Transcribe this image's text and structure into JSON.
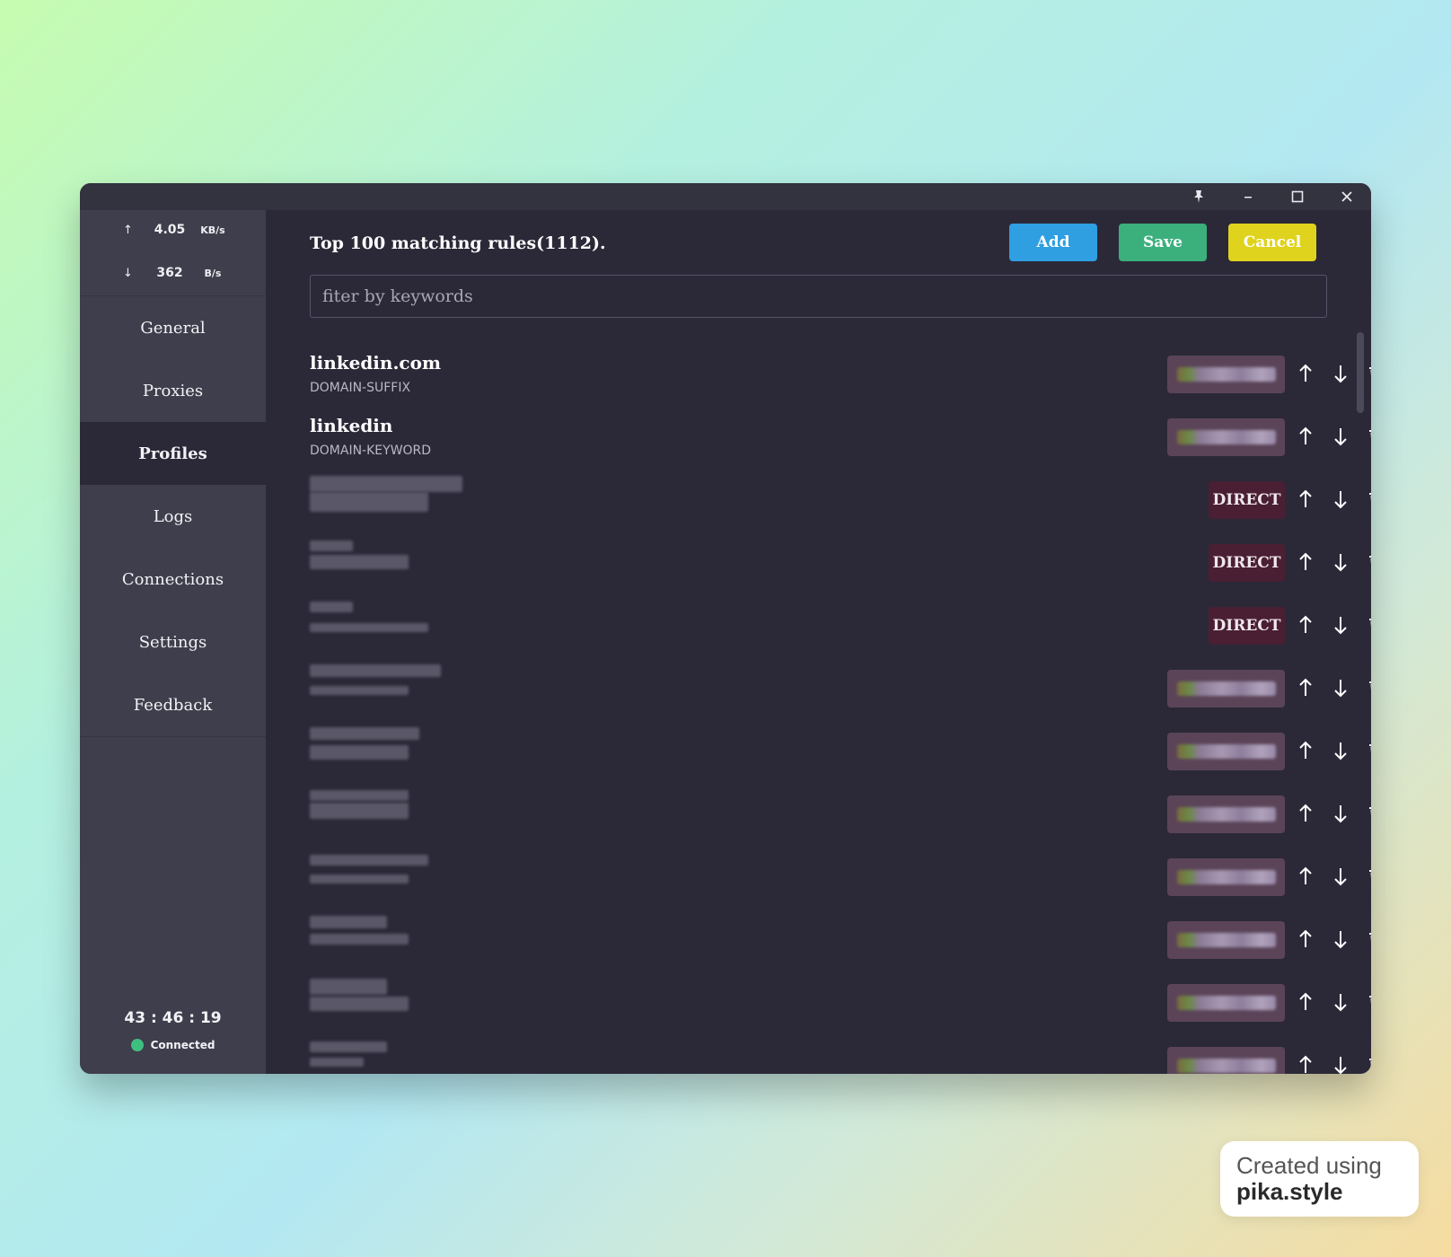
{
  "window": {
    "controls": [
      "pin-icon",
      "minimize-icon",
      "maximize-icon",
      "close-icon"
    ]
  },
  "sidebar": {
    "traffic": {
      "up_arrow": "↑",
      "up_value": "4.05",
      "up_unit": "KB/s",
      "down_arrow": "↓",
      "down_value": "362",
      "down_unit": "B/s"
    },
    "nav": [
      {
        "label": "General"
      },
      {
        "label": "Proxies"
      },
      {
        "label": "Profiles"
      },
      {
        "label": "Logs"
      },
      {
        "label": "Connections"
      },
      {
        "label": "Settings"
      },
      {
        "label": "Feedback"
      }
    ],
    "active_index": 2,
    "timer": "43 : 46 : 19",
    "status_label": "Connected",
    "status_color": "#3fbf7f"
  },
  "main": {
    "title": "Top 100 matching rules(1112).",
    "buttons": {
      "add": "Add",
      "save": "Save",
      "cancel": "Cancel"
    },
    "button_colors": {
      "add": "#2f9fe2",
      "save": "#3bb07d",
      "cancel": "#e0d31e"
    },
    "filter_placeholder": "fiter by keywords",
    "filter_value": "",
    "rules": [
      {
        "payload": "linkedin.com",
        "type": "DOMAIN-SUFFIX",
        "policy": "",
        "policy_kind": "blurred"
      },
      {
        "payload": "linkedin",
        "type": "DOMAIN-KEYWORD",
        "policy": "",
        "policy_kind": "blurred"
      },
      {
        "payload": "",
        "type": "",
        "policy": "DIRECT",
        "policy_kind": "direct"
      },
      {
        "payload": "",
        "type": "",
        "policy": "DIRECT",
        "policy_kind": "direct"
      },
      {
        "payload": "",
        "type": "",
        "policy": "DIRECT",
        "policy_kind": "direct"
      },
      {
        "payload": "",
        "type": "",
        "policy": "",
        "policy_kind": "blurred"
      },
      {
        "payload": "",
        "type": "",
        "policy": "",
        "policy_kind": "blurred"
      },
      {
        "payload": "",
        "type": "",
        "policy": "",
        "policy_kind": "blurred"
      },
      {
        "payload": "",
        "type": "",
        "policy": "",
        "policy_kind": "blurred"
      },
      {
        "payload": "",
        "type": "",
        "policy": "",
        "policy_kind": "blurred"
      },
      {
        "payload": "",
        "type": "",
        "policy": "",
        "policy_kind": "blurred"
      },
      {
        "payload": "",
        "type": "",
        "policy": "",
        "policy_kind": "blurred"
      }
    ],
    "row_actions": [
      "arrow-up-icon",
      "arrow-down-icon",
      "trash-icon"
    ]
  },
  "watermark": {
    "line1": "Created using",
    "line2": "pika.style"
  }
}
